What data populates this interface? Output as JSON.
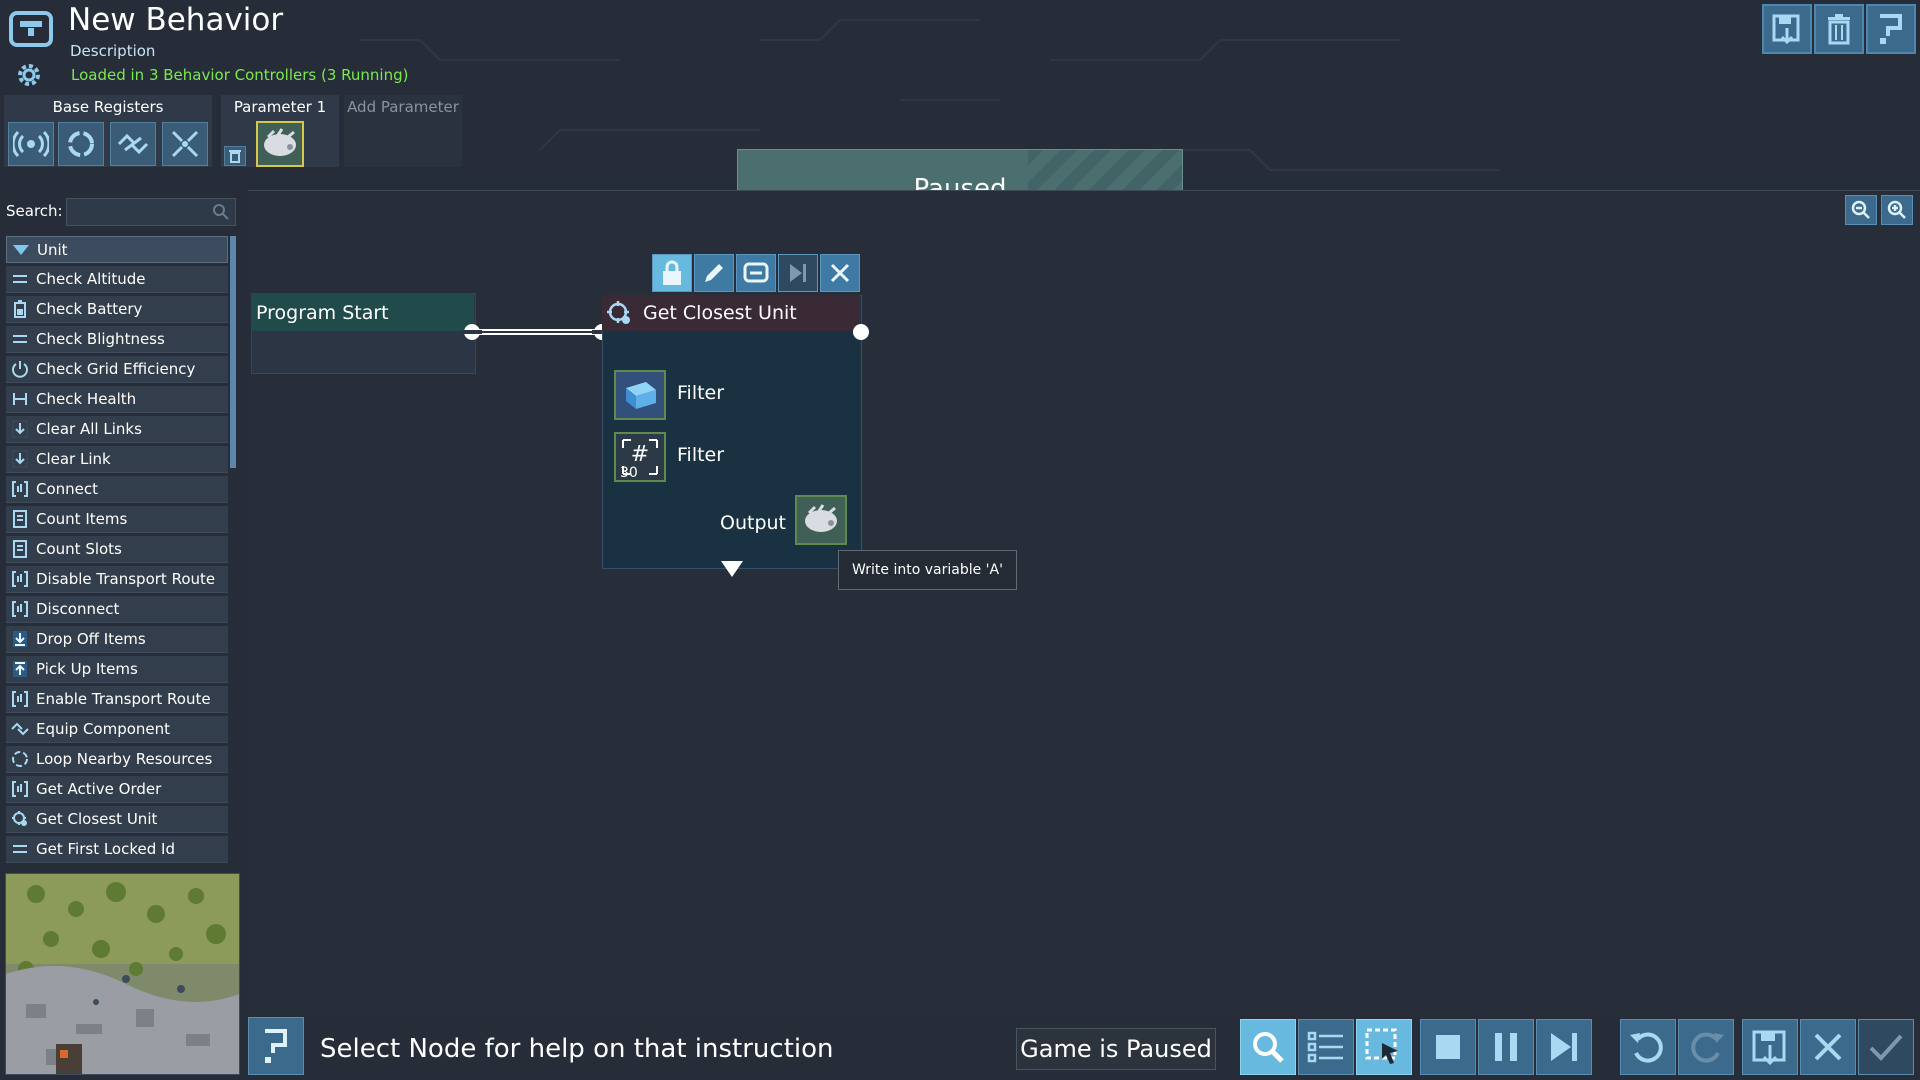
{
  "header": {
    "title": "New Behavior",
    "description": "Description",
    "status": "Loaded in 3 Behavior Controllers (3 Running)"
  },
  "registers": {
    "base_title": "Base Registers",
    "tab_param1": "Parameter 1",
    "tab_add": "Add Parameter",
    "base_icons": [
      "signal-icon",
      "sync-icon",
      "link-icon",
      "scatter-icon"
    ]
  },
  "banner": {
    "label": "Paused"
  },
  "sidebar": {
    "search_label": "Search:",
    "search_value": "",
    "category": "Unit",
    "items": [
      {
        "label": "Check Altitude",
        "icon": "lines-icon"
      },
      {
        "label": "Check Battery",
        "icon": "battery-icon"
      },
      {
        "label": "Check Blightness",
        "icon": "lines-icon"
      },
      {
        "label": "Check Grid Efficiency",
        "icon": "power-icon"
      },
      {
        "label": "Check Health",
        "icon": "health-icon"
      },
      {
        "label": "Clear All Links",
        "icon": "arrow-down-icon"
      },
      {
        "label": "Clear Link",
        "icon": "arrow-down-icon"
      },
      {
        "label": "Connect",
        "icon": "bracket-icon"
      },
      {
        "label": "Count Items",
        "icon": "doc-icon"
      },
      {
        "label": "Count Slots",
        "icon": "doc-icon"
      },
      {
        "label": "Disable Transport Route",
        "icon": "bracket-icon"
      },
      {
        "label": "Disconnect",
        "icon": "bracket-icon"
      },
      {
        "label": "Drop Off Items",
        "icon": "drop-icon"
      },
      {
        "label": "Pick Up Items",
        "icon": "pickup-icon"
      },
      {
        "label": "Enable Transport Route",
        "icon": "bracket-icon"
      },
      {
        "label": "Equip Component",
        "icon": "link-icon"
      },
      {
        "label": "Loop Nearby Resources",
        "icon": "loop-icon"
      },
      {
        "label": "Get Active Order",
        "icon": "bracket-icon"
      },
      {
        "label": "Get Closest Unit",
        "icon": "target-icon"
      },
      {
        "label": "Get First Locked Id",
        "icon": "lines-icon"
      }
    ]
  },
  "nodes": {
    "start": {
      "label": "Program Start"
    },
    "gcu": {
      "label": "Get Closest Unit",
      "filter1": "Filter",
      "filter2": "Filter",
      "filter2_value": "30",
      "output": "Output"
    },
    "toolbar": [
      "lock-icon",
      "pencil-icon",
      "box-icon",
      "step-icon",
      "close-icon"
    ]
  },
  "tooltip": "Write into variable 'A'",
  "footer": {
    "help_text": "Select Node for help on that instruction",
    "game_status": "Game is Paused"
  },
  "colors": {
    "background": "#262d39",
    "accent": "#3c6a8c",
    "status_green": "#7be84f",
    "slot_highlight": "#d4c94a"
  }
}
